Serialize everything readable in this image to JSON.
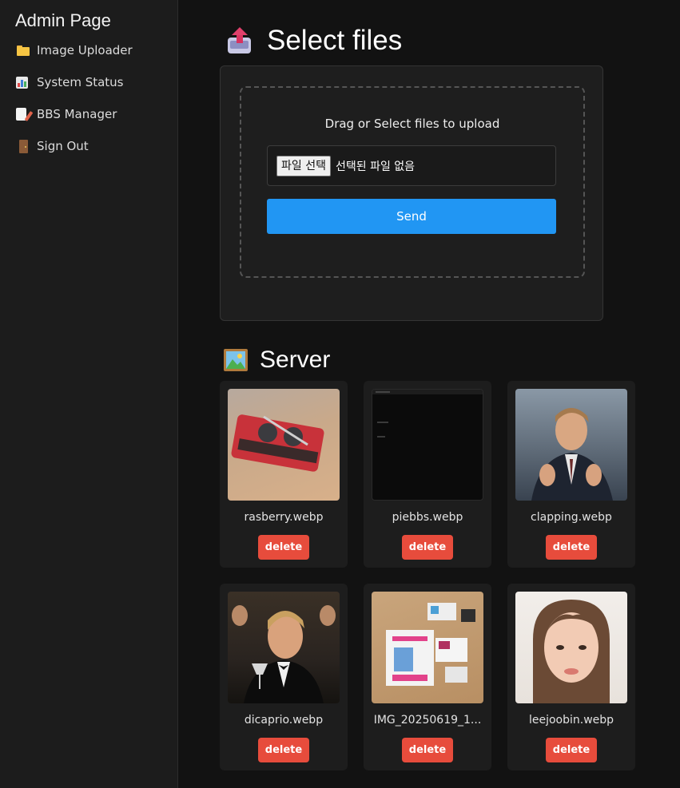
{
  "sidebar": {
    "title": "Admin Page",
    "items": [
      {
        "label": "Image Uploader",
        "icon": "folder-icon"
      },
      {
        "label": "System Status",
        "icon": "bar-chart-icon"
      },
      {
        "label": "BBS Manager",
        "icon": "memo-icon"
      },
      {
        "label": "Sign Out",
        "icon": "door-icon"
      }
    ]
  },
  "upload": {
    "title": "Select files",
    "drop_text": "Drag or Select files to upload",
    "file_button_label": "파일 선택",
    "file_status": "선택된 파일 없음",
    "send_label": "Send",
    "accent_color": "#2196f3"
  },
  "server": {
    "title": "Server",
    "delete_label": "delete",
    "delete_color": "#e74c3c",
    "files": [
      {
        "name": "rasberry.webp"
      },
      {
        "name": "piebbs.webp"
      },
      {
        "name": "clapping.webp"
      },
      {
        "name": "dicaprio.webp"
      },
      {
        "name": "IMG_20250619_1..."
      },
      {
        "name": "leejoobin.webp"
      }
    ]
  }
}
